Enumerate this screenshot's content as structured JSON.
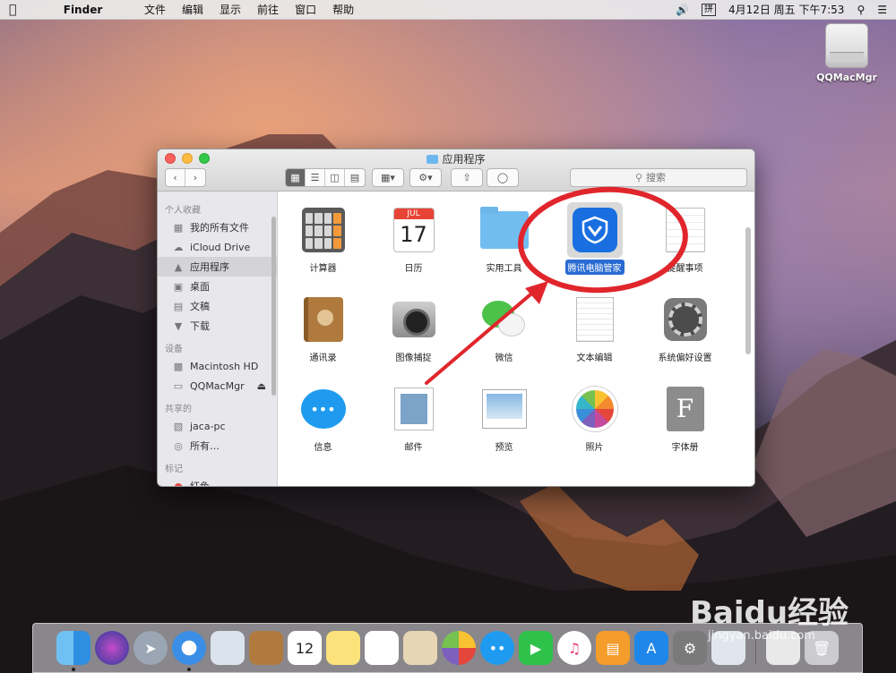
{
  "menubar": {
    "app_name": "Finder",
    "menus": [
      "文件",
      "编辑",
      "显示",
      "前往",
      "窗口",
      "帮助"
    ],
    "ime_label": "拼",
    "datetime": "4月12日 周五 下午7:53"
  },
  "desktop": {
    "drive_label": "QQMacMgr"
  },
  "window": {
    "title": "应用程序",
    "search_placeholder": "搜索",
    "sidebar": {
      "favorites_heading": "个人收藏",
      "favorites": [
        "我的所有文件",
        "iCloud Drive",
        "应用程序",
        "桌面",
        "文稿",
        "下载"
      ],
      "devices_heading": "设备",
      "devices": [
        "Macintosh HD",
        "QQMacMgr"
      ],
      "shared_heading": "共享的",
      "shared": [
        "jaca-pc",
        "所有…"
      ],
      "tags_heading": "标记",
      "tags": [
        "红色"
      ]
    },
    "apps": {
      "row1": [
        "计算器",
        "日历",
        "实用工具",
        "腾讯电脑管家",
        "提醒事项"
      ],
      "row2": [
        "通讯录",
        "图像捕捉",
        "微信",
        "文本编辑",
        "系统偏好设置"
      ],
      "row3": [
        "信息",
        "邮件",
        "预览",
        "照片",
        "字体册"
      ]
    },
    "calendar_icon": {
      "month": "JUL",
      "day": "17"
    }
  },
  "dock": {
    "calendar_day": "12"
  },
  "watermark": {
    "brand": "Baidu经验",
    "url": "jingyan.baidu.com"
  },
  "colors": {
    "selection_blue": "#2a6bd3",
    "annotation_red": "#e0262c"
  }
}
